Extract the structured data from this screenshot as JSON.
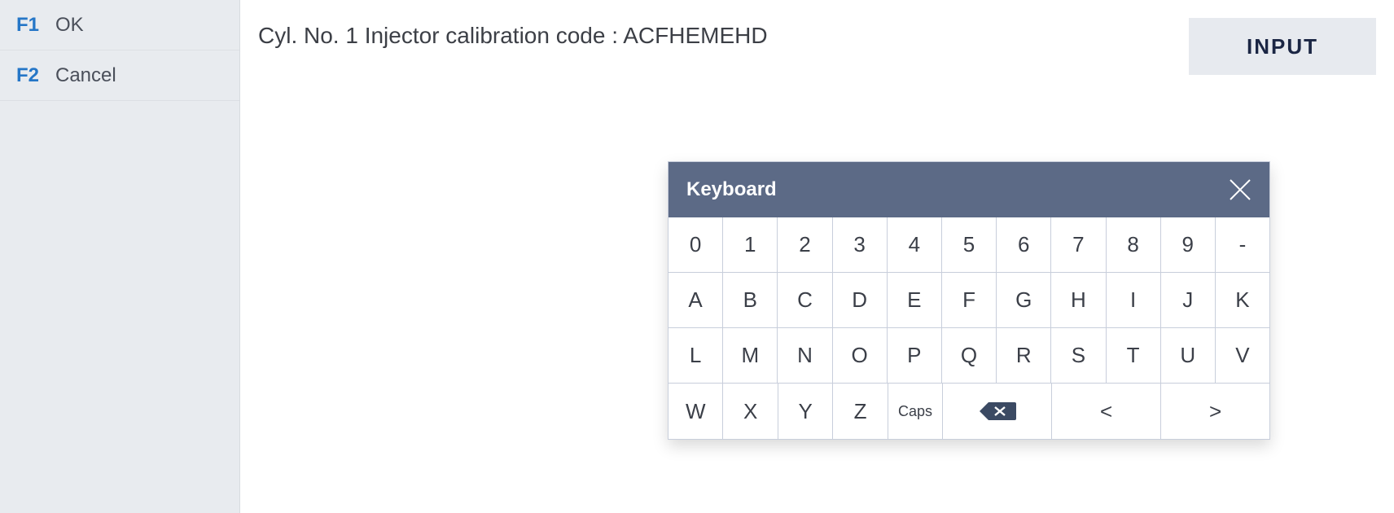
{
  "sidebar": {
    "items": [
      {
        "key": "F1",
        "label": "OK"
      },
      {
        "key": "F2",
        "label": "Cancel"
      }
    ]
  },
  "main": {
    "prompt": "Cyl. No. 1 Injector calibration code : ACFHEMEHD",
    "input_button": "INPUT"
  },
  "keyboard": {
    "title": "Keyboard",
    "rows": {
      "r0": [
        "0",
        "1",
        "2",
        "3",
        "4",
        "5",
        "6",
        "7",
        "8",
        "9",
        "-"
      ],
      "r1": [
        "A",
        "B",
        "C",
        "D",
        "E",
        "F",
        "G",
        "H",
        "I",
        "J",
        "K"
      ],
      "r2": [
        "L",
        "M",
        "N",
        "O",
        "P",
        "Q",
        "R",
        "S",
        "T",
        "U",
        "V"
      ],
      "r3": {
        "k0": "W",
        "k1": "X",
        "k2": "Y",
        "k3": "Z",
        "caps": "Caps",
        "lt": "<",
        "gt": ">"
      }
    }
  }
}
